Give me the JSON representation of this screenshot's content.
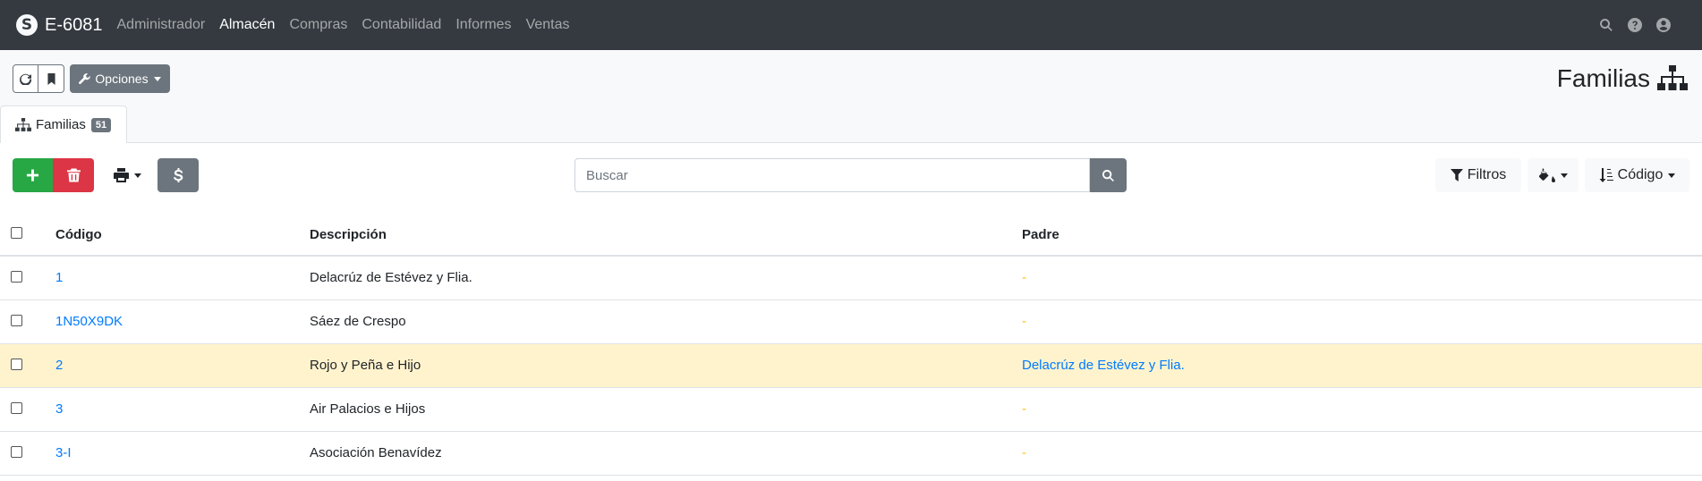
{
  "navbar": {
    "brand": "E-6081",
    "logo_glyph": "S",
    "links": [
      {
        "label": "Administrador",
        "active": false
      },
      {
        "label": "Almacén",
        "active": true
      },
      {
        "label": "Compras",
        "active": false
      },
      {
        "label": "Contabilidad",
        "active": false
      },
      {
        "label": "Informes",
        "active": false
      },
      {
        "label": "Ventas",
        "active": false
      }
    ],
    "icons": [
      "search-icon",
      "help-icon",
      "user-icon"
    ]
  },
  "toolbar": {
    "options_label": "Opciones"
  },
  "page": {
    "title": "Familias"
  },
  "tab": {
    "label": "Familias",
    "count": "51"
  },
  "actions": {
    "search_placeholder": "Buscar",
    "filters_label": "Filtros",
    "order_label": "Código"
  },
  "table": {
    "headers": {
      "code": "Código",
      "description": "Descripción",
      "parent": "Padre"
    },
    "rows": [
      {
        "code": "1",
        "description": "Delacrúz de Estévez y Flia.",
        "parent": "-"
      },
      {
        "code": "1N50X9DK",
        "description": "Sáez de Crespo",
        "parent": "-"
      },
      {
        "code": "2",
        "description": "Rojo y Peña e Hijo",
        "parent": "Delacrúz de Estévez y Flia."
      },
      {
        "code": "3",
        "description": "Air Palacios e Hijos",
        "parent": "-"
      },
      {
        "code": "3-I",
        "description": "Asociación Benavídez",
        "parent": "-"
      }
    ]
  },
  "colors": {
    "navbar_bg": "#343a40",
    "success": "#28a745",
    "danger": "#dc3545",
    "secondary": "#6c757d",
    "link": "#007bff",
    "highlight_row": "#fff3cd"
  }
}
